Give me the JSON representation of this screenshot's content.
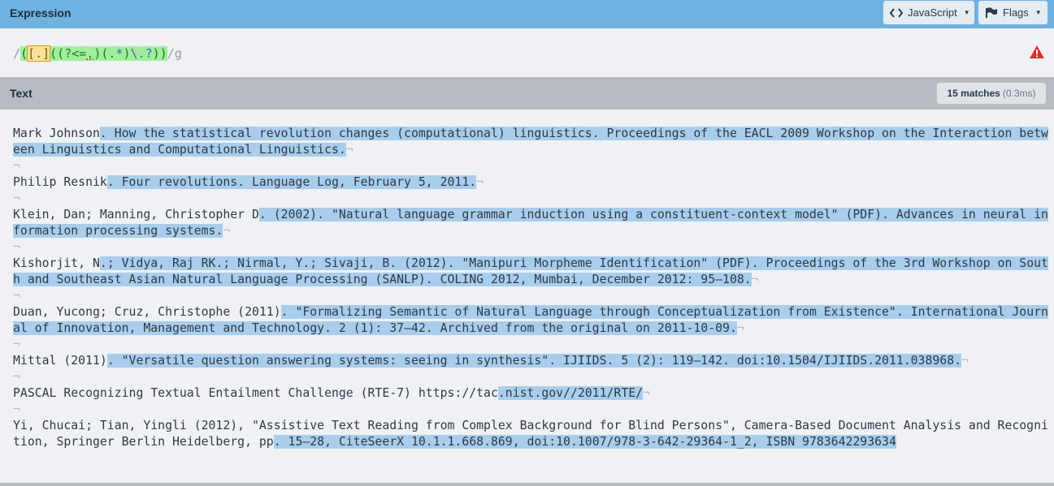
{
  "expression": {
    "title": "Expression",
    "flavor_button": "JavaScript",
    "flags_button": "Flags",
    "regex": {
      "open_delim": "/",
      "group_open": "(",
      "char_set": "[.]",
      "inner_open": "((?<=",
      "lookbehind_char": ".",
      "inner_mid": ")(",
      "dot_any": ".",
      "star": "*",
      "inner_close": ")",
      "escaped_dot": "\\.",
      "optional": "?",
      "group_close": "))",
      "close_delim": "/",
      "flags": "g"
    }
  },
  "text_panel": {
    "title": "Text",
    "match_count": "15 matches",
    "match_time": "(0.3ms)"
  },
  "paragraphs": [
    {
      "pre": "Mark Johnson",
      "match": ". How the statistical revolution changes (computational) linguistics. Proceedings of the EACL 2009 Workshop on the Interaction between Linguistics and Computational Linguistics.",
      "post": "¬"
    },
    {
      "pre": "Philip Resnik",
      "match": ". Four revolutions. Language Log, February 5, 2011.",
      "post": "¬"
    },
    {
      "pre": "Klein, Dan; Manning, Christopher D",
      "match": ". (2002). \"Natural language grammar induction using a constituent-context model\" (PDF). Advances in neural information processing systems.",
      "post": "¬"
    },
    {
      "pre": "Kishorjit, N",
      "match": ".; Vidya, Raj RK.; Nirmal, Y.; Sivaji, B. (2012). \"Manipuri Morpheme Identification\" (PDF). Proceedings of the 3rd Workshop on South and Southeast Asian Natural Language Processing (SANLP). COLING 2012, Mumbai, December 2012: 95–108.",
      "post": "¬"
    },
    {
      "pre": "Duan, Yucong; Cruz, Christophe (2011)",
      "match": ". \"Formalizing Semantic of Natural Language through Conceptualization from Existence\". International Journal of Innovation, Management and Technology. 2 (1): 37–42. Archived from the original on 2011-10-09.",
      "post": "¬"
    },
    {
      "pre": "Mittal (2011)",
      "match": ". \"Versatile question answering systems: seeing in synthesis\". IJIIDS. 5 (2): 119–142. doi:10.1504/IJIIDS.2011.038968.",
      "post": "¬"
    },
    {
      "pre": "PASCAL Recognizing Textual Entailment Challenge (RTE-7) https://tac",
      "match": ".nist.gov//2011/RTE/",
      "post": "¬"
    },
    {
      "pre": "Yi, Chucai; Tian, Yingli (2012), \"Assistive Text Reading from Complex Background for Blind Persons\", Camera-Based Document Analysis and Recognition, Springer Berlin Heidelberg, pp",
      "match": ". 15–28, CiteSeerX 10.1.1.668.869, doi:10.1007/978-3-642-29364-1_2, ISBN 9783642293634",
      "post": ""
    }
  ],
  "colors": {
    "header_blue": "#6fb1e1",
    "match_highlight": "#a9cdec",
    "warning_red": "#d9302e"
  },
  "icons": {
    "javascript": "code-brackets-icon",
    "flags": "flag-icon",
    "warning": "warning-triangle-icon"
  }
}
